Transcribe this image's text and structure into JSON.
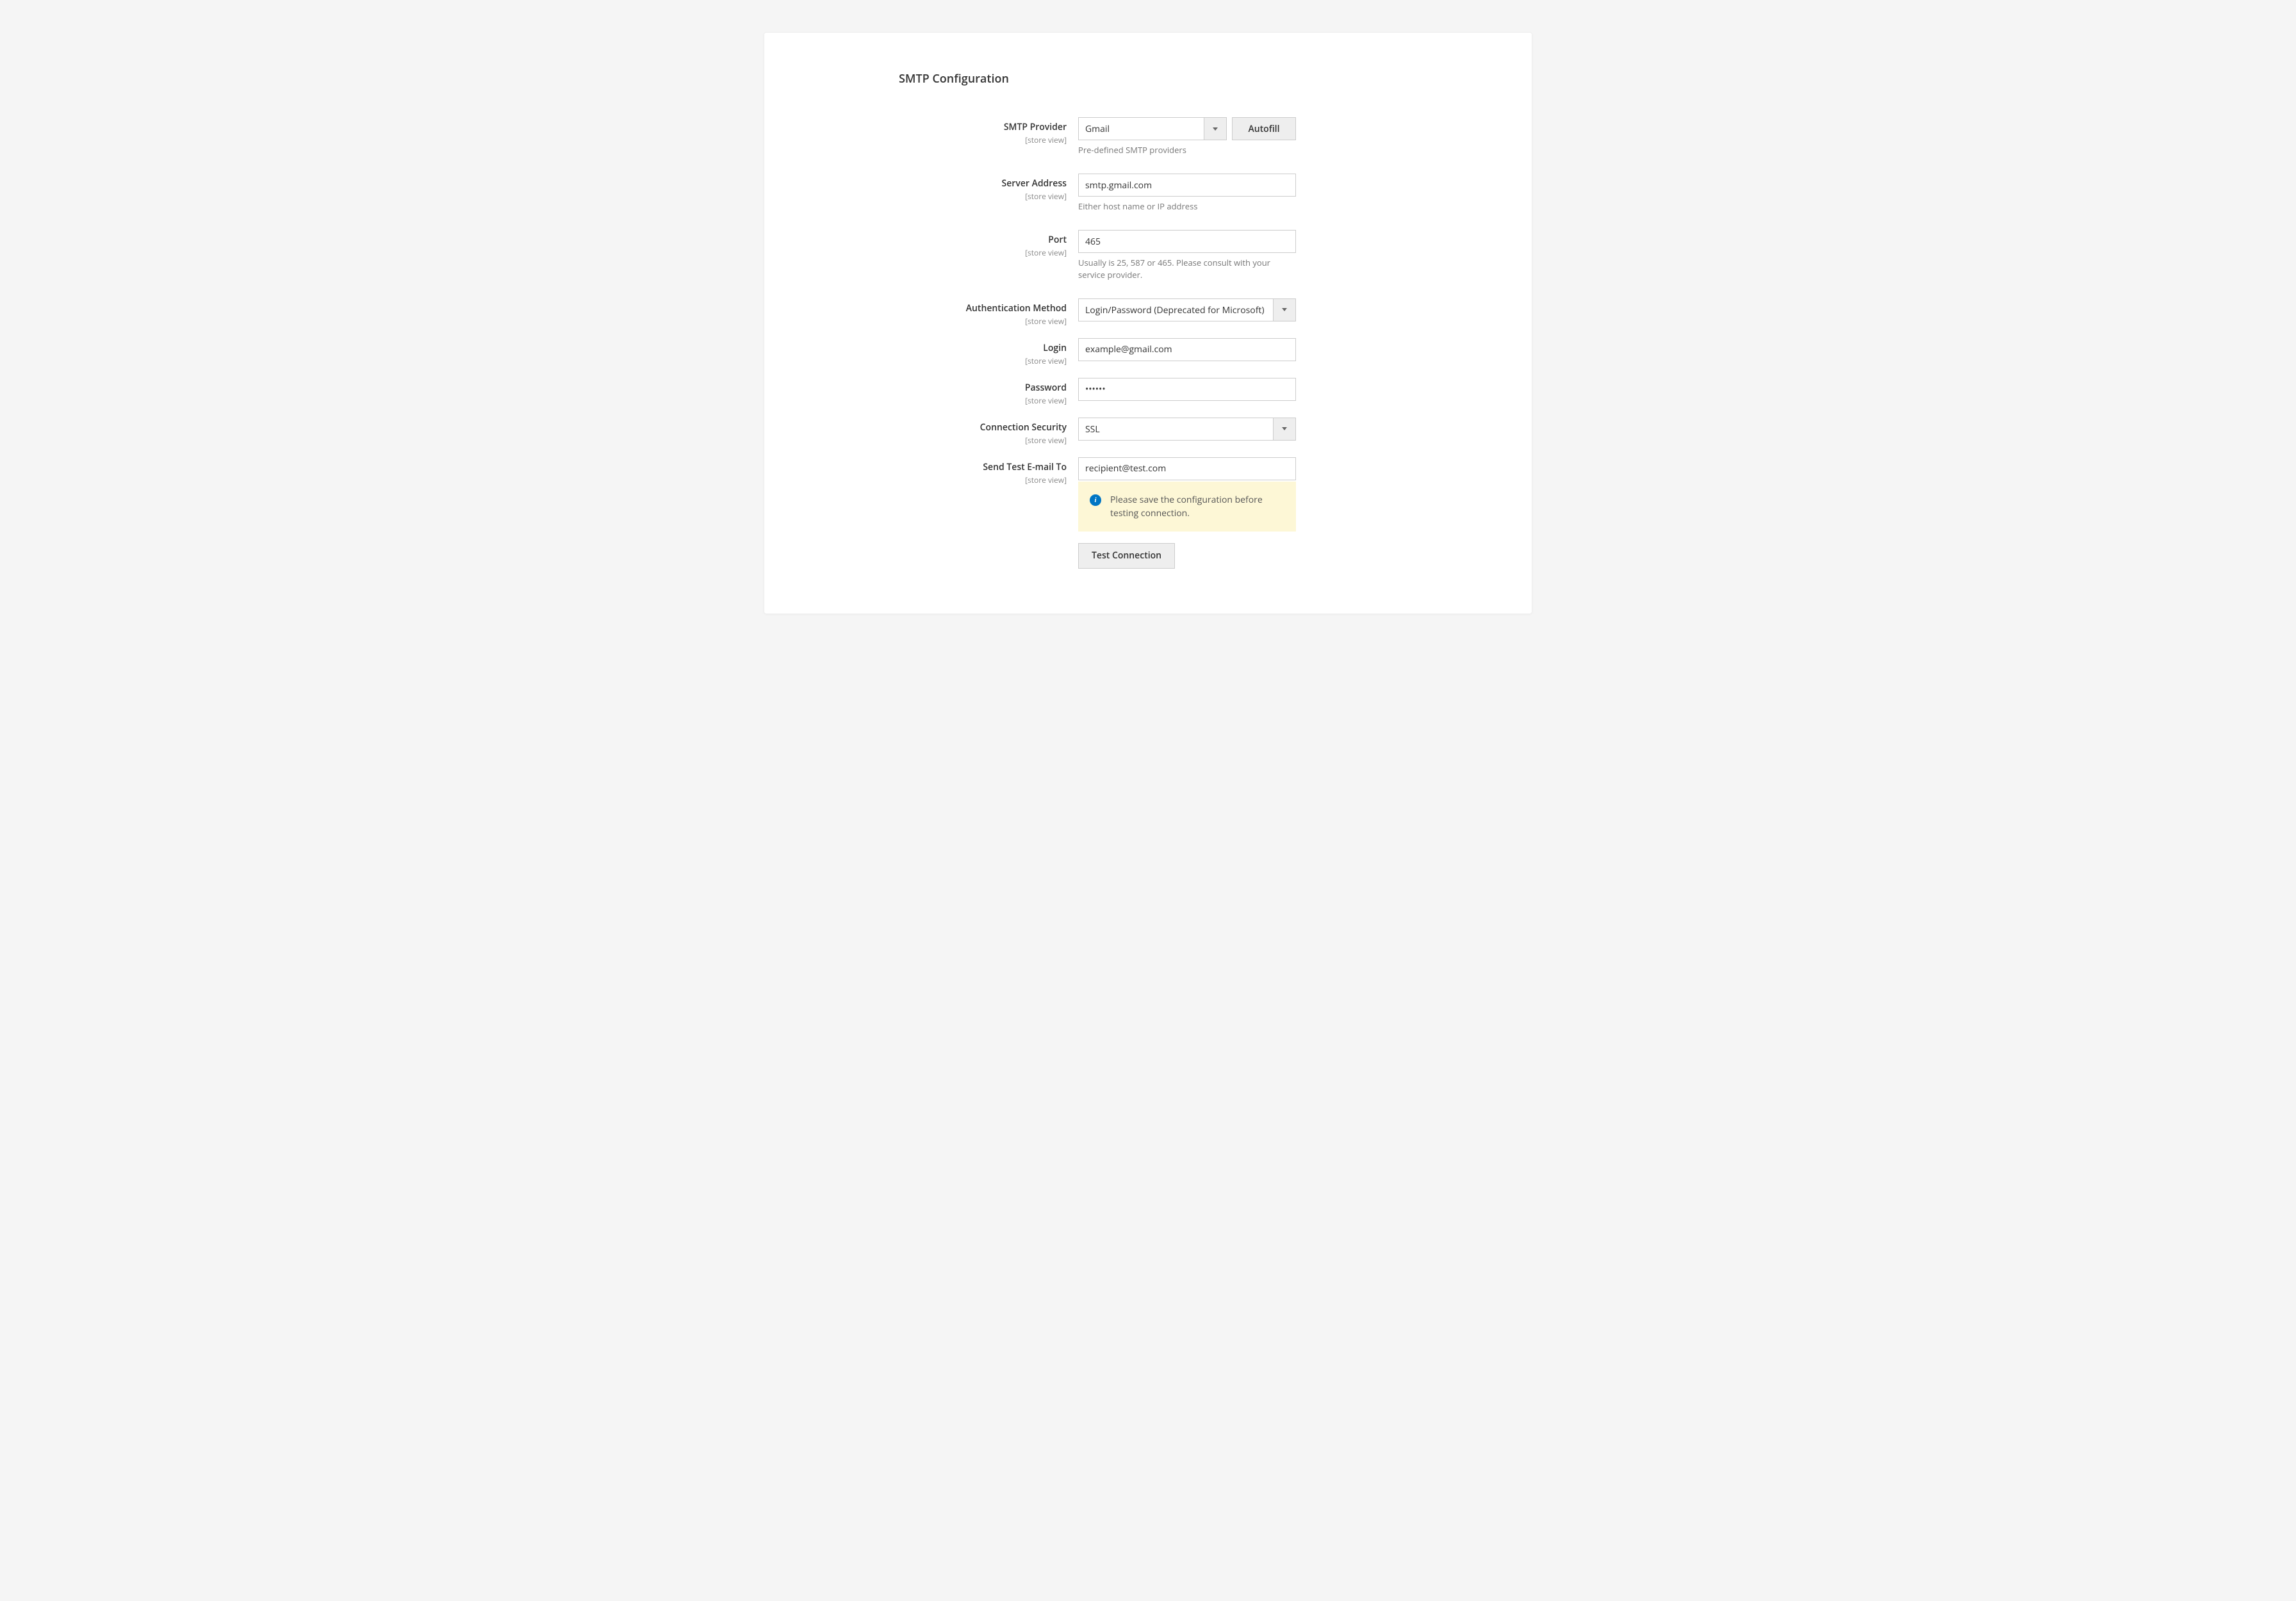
{
  "section_title": "SMTP Configuration",
  "scope_label": "[store view]",
  "fields": {
    "provider": {
      "label": "SMTP Provider",
      "value": "Gmail",
      "autofill_label": "Autofill",
      "help": "Pre-defined SMTP providers"
    },
    "server": {
      "label": "Server Address",
      "value": "smtp.gmail.com",
      "help": "Either host name or IP address"
    },
    "port": {
      "label": "Port",
      "value": "465",
      "help": "Usually is 25, 587 or 465. Please consult with your service provider."
    },
    "auth": {
      "label": "Authentication Method",
      "value": "Login/Password (Deprecated for Microsoft)"
    },
    "login": {
      "label": "Login",
      "value": "example@gmail.com"
    },
    "password": {
      "label": "Password",
      "value": "••••••"
    },
    "security": {
      "label": "Connection Security",
      "value": "SSL"
    },
    "test_email": {
      "label": "Send Test E-mail To",
      "value": "recipient@test.com"
    }
  },
  "notice": "Please save the configuration before testing connection.",
  "test_button_label": "Test Connection"
}
